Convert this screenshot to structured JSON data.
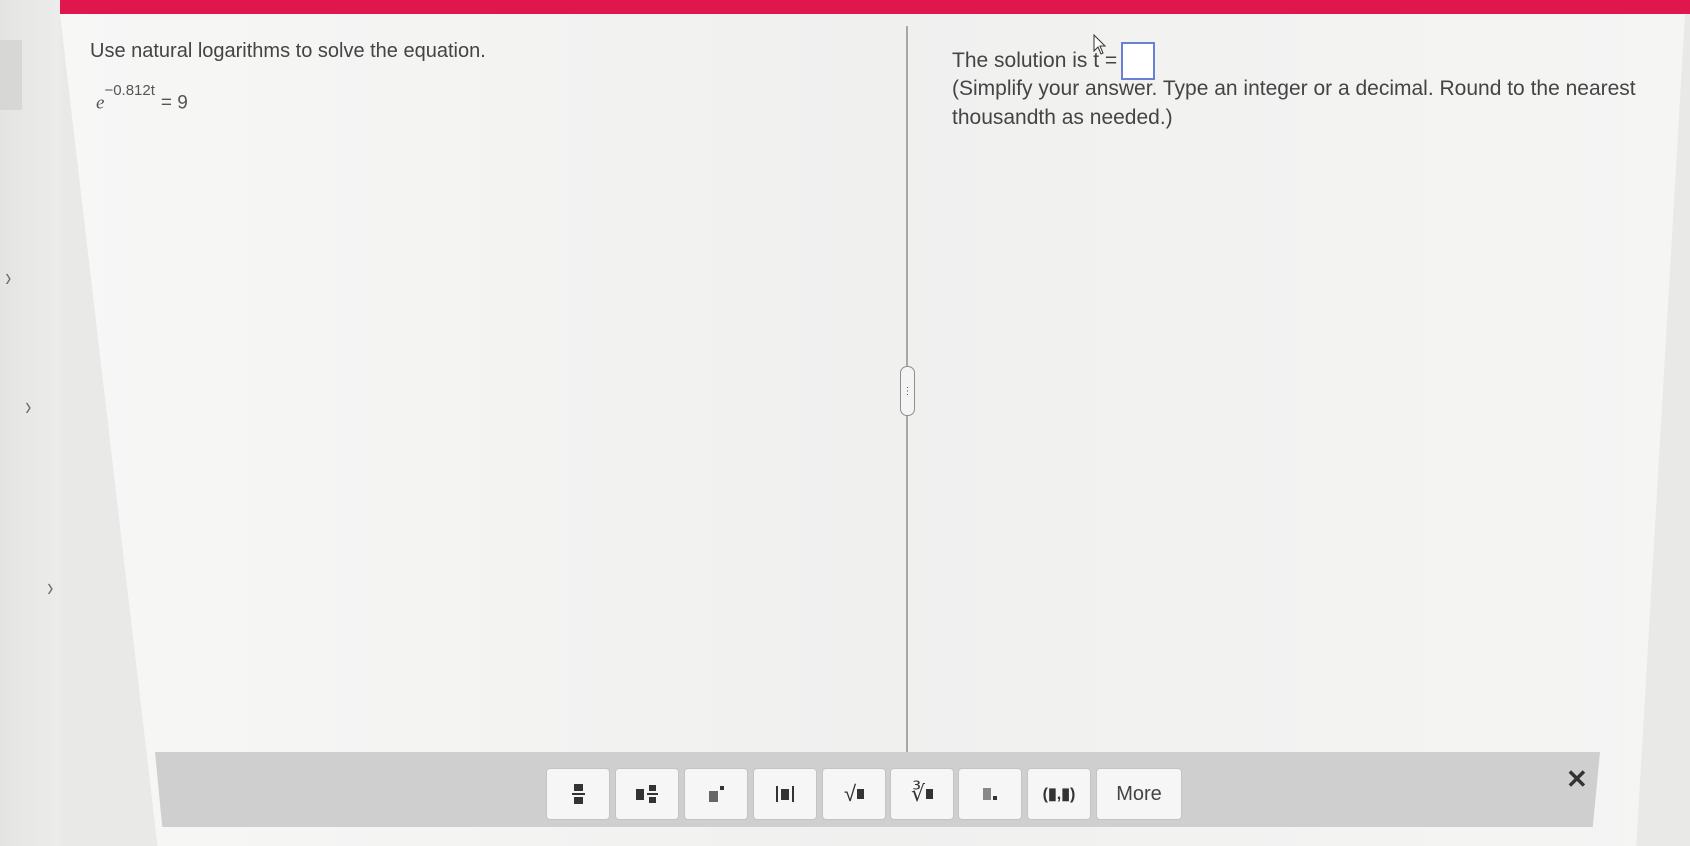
{
  "question": {
    "instruction": "Use natural logarithms to solve the equation.",
    "equation": {
      "base": "e",
      "exponent": "−0.812t",
      "rhs": "= 9"
    }
  },
  "answer": {
    "prefix": "The solution is t =",
    "hint": "(Simplify your answer. Type an integer or a decimal. Round to the nearest thousandth as needed.)",
    "value": ""
  },
  "toolbar": {
    "buttons": [
      "fraction",
      "mixed-number",
      "exponent",
      "absolute-value",
      "square-root",
      "nth-root",
      "subscript",
      "ordered-pair"
    ],
    "sqrt_symbol": "√",
    "nth_root_symbol": "∛",
    "ordered_pair_text": "(▮,▮)",
    "more_label": "More",
    "close_symbol": "✕"
  },
  "colors": {
    "accent_bar": "#e0174d",
    "answer_box_border": "#6a7fd6"
  },
  "icons": {
    "left_chevron": "chevron-right-icon",
    "close": "close-icon"
  }
}
